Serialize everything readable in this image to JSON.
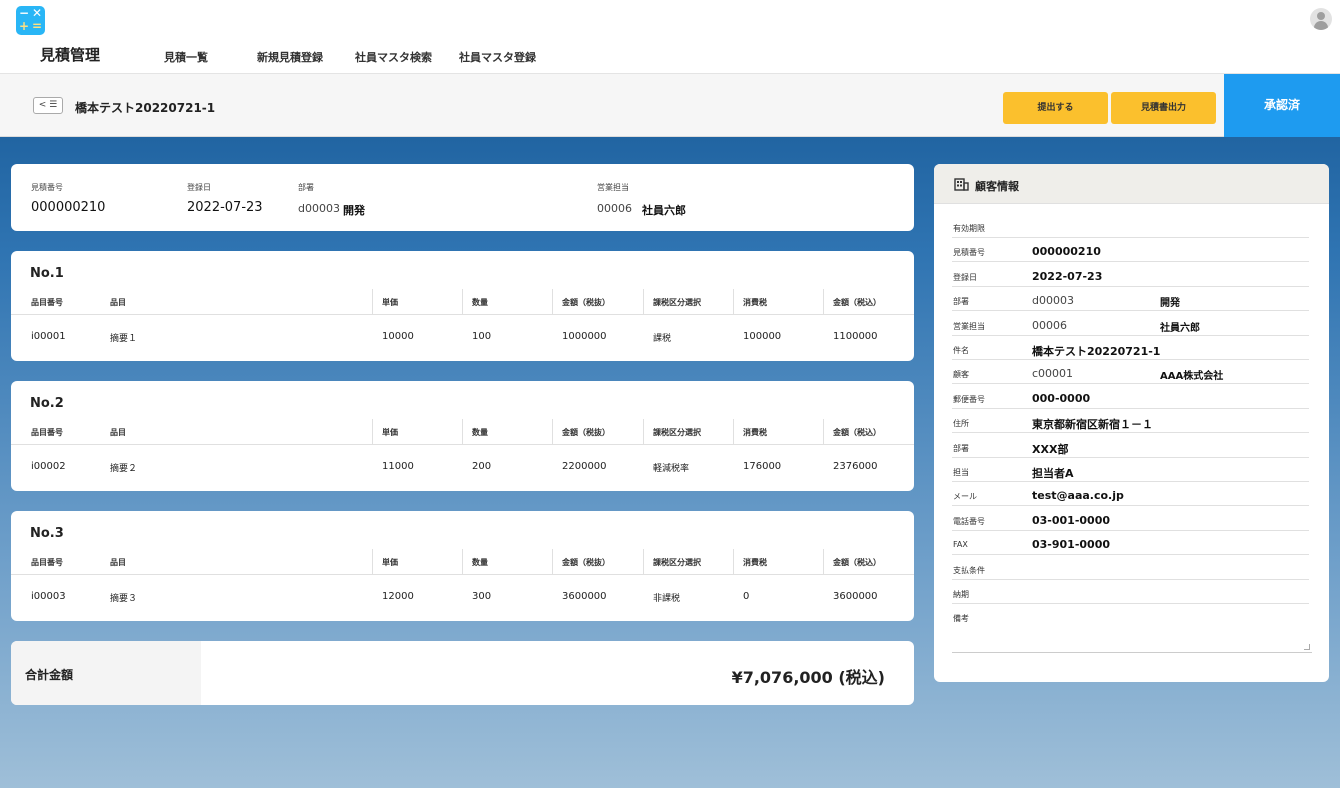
{
  "app": {
    "title": "見積管理",
    "logo_glyphs": [
      "−",
      "✕",
      "+",
      "="
    ]
  },
  "nav": [
    {
      "label": "見積一覧"
    },
    {
      "label": "新規見積登録"
    },
    {
      "label": "社員マスタ検索"
    },
    {
      "label": "社員マスタ登録"
    }
  ],
  "subheader": {
    "back_label": "< ☰",
    "doc_title": "橋本テスト20220721-1",
    "submit_button": "提出する",
    "print_button": "見積書出力",
    "status": "承認済"
  },
  "summary": {
    "estimate_no_label": "見積番号",
    "estimate_no": "000000210",
    "reg_date_label": "登録日",
    "reg_date": "2022-07-23",
    "dept_label": "部署",
    "dept_code": "d00003",
    "dept_name": "開発",
    "sales_label": "営業担当",
    "sales_code": "00006",
    "sales_name": "社員六郎"
  },
  "columns": [
    "品目番号",
    "品目",
    "単価",
    "数量",
    "金額（税抜）",
    "課税区分選択",
    "消費税",
    "金額（税込）"
  ],
  "items": [
    {
      "no": "No.1",
      "code": "i00001",
      "name": "摘要１",
      "price": "10000",
      "qty": "100",
      "amount": "1000000",
      "tax_type": "課税",
      "tax": "100000",
      "total": "1100000"
    },
    {
      "no": "No.2",
      "code": "i00002",
      "name": "摘要２",
      "price": "11000",
      "qty": "200",
      "amount": "2200000",
      "tax_type": "軽減税率",
      "tax": "176000",
      "total": "2376000"
    },
    {
      "no": "No.3",
      "code": "i00003",
      "name": "摘要３",
      "price": "12000",
      "qty": "300",
      "amount": "3600000",
      "tax_type": "非課税",
      "tax": "0",
      "total": "3600000"
    }
  ],
  "total": {
    "label": "合計金額",
    "value": "¥7,076,000 (税込)"
  },
  "customer": {
    "title": "顧客情報",
    "rows": [
      {
        "label": "有効期限",
        "value": "",
        "value2": ""
      },
      {
        "label": "見積番号",
        "value": "000000210",
        "value2": ""
      },
      {
        "label": "登録日",
        "value": "2022-07-23",
        "value2": ""
      },
      {
        "label": "部署",
        "value": "d00003",
        "value2": "開発"
      },
      {
        "label": "営業担当",
        "value": "00006",
        "value2": "社員六郎"
      },
      {
        "label": "件名",
        "value": "橋本テスト20220721-1",
        "value2": ""
      },
      {
        "label": "顧客",
        "value": "c00001",
        "value2": "AAA株式会社"
      },
      {
        "label": "郵便番号",
        "value": "000-0000",
        "value2": ""
      },
      {
        "label": "住所",
        "value": "東京都新宿区新宿１－１",
        "value2": ""
      },
      {
        "label": "部署",
        "value": "XXX部",
        "value2": ""
      },
      {
        "label": "担当",
        "value": "担当者A",
        "value2": ""
      },
      {
        "label": "メール",
        "value": "test@aaa.co.jp",
        "value2": ""
      },
      {
        "label": "電話番号",
        "value": "03-001-0000",
        "value2": ""
      },
      {
        "label": "FAX",
        "value": "03-901-0000",
        "value2": ""
      },
      {
        "label": "支払条件",
        "value": "",
        "value2": ""
      },
      {
        "label": "納期",
        "value": "",
        "value2": ""
      },
      {
        "label": "備考",
        "value": "",
        "value2": ""
      }
    ]
  },
  "colors": {
    "accent_yellow": "#fbc02d",
    "status_blue": "#1e9bf0",
    "logo_blue": "#29b6f6"
  }
}
